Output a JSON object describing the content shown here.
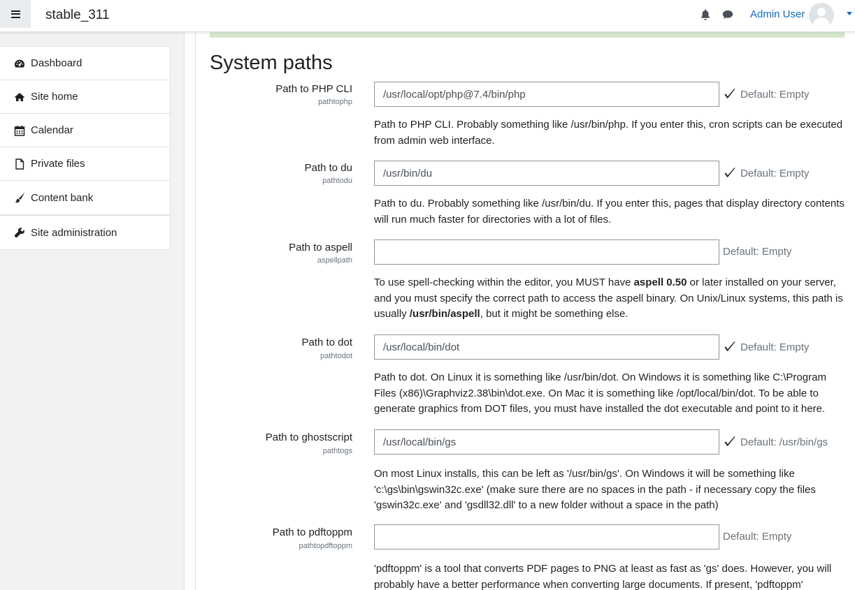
{
  "navbar": {
    "site_name": "stable_311",
    "user_name": "Admin User",
    "icons": [
      "menu-icon",
      "bell-icon",
      "chat-icon",
      "user-avatar",
      "caret-down-icon"
    ]
  },
  "drawer": {
    "items": [
      {
        "label": "Dashboard",
        "icon": "dashboard-icon"
      },
      {
        "label": "Site home",
        "icon": "home-icon"
      },
      {
        "label": "Calendar",
        "icon": "calendar-icon"
      },
      {
        "label": "Private files",
        "icon": "file-icon"
      },
      {
        "label": "Content bank",
        "icon": "paintbrush-icon"
      }
    ],
    "admin_item": {
      "label": "Site administration",
      "icon": "wrench-icon"
    }
  },
  "page": {
    "section_title": "System paths",
    "settings": [
      {
        "label": "Path to PHP CLI",
        "name": "pathtophp",
        "value": "/usr/local/opt/php@7.4/bin/php",
        "default": "Default: Empty",
        "changed": true,
        "description": "Path to PHP CLI. Probably something like /usr/bin/php. If you enter this, cron scripts can be executed from admin web interface."
      },
      {
        "label": "Path to du",
        "name": "pathtodu",
        "value": "/usr/bin/du",
        "default": "Default: Empty",
        "changed": true,
        "description": "Path to du. Probably something like /usr/bin/du. If you enter this, pages that display directory contents will run much faster for directories with a lot of files."
      },
      {
        "label": "Path to aspell",
        "name": "aspellpath",
        "value": "",
        "default": "Default: Empty",
        "changed": false,
        "description_parts": {
          "p1": "To use spell-checking within the editor, you MUST have ",
          "b1": "aspell 0.50",
          "p2": " or later installed on your server, and you must specify the correct path to access the aspell binary. On Unix/Linux systems, this path is usually ",
          "b2": "/usr/bin/aspell",
          "p3": ", but it might be something else."
        }
      },
      {
        "label": "Path to dot",
        "name": "pathtodot",
        "value": "/usr/local/bin/dot",
        "default": "Default: Empty",
        "changed": true,
        "description": "Path to dot. On Linux it is something like /usr/bin/dot. On Windows it is something like C:\\Program Files (x86)\\Graphviz2.38\\bin\\dot.exe. On Mac it is something like /opt/local/bin/dot. To be able to generate graphics from DOT files, you must have installed the dot executable and point to it here."
      },
      {
        "label": "Path to ghostscript",
        "name": "pathtogs",
        "value": "/usr/local/bin/gs",
        "default": "Default: /usr/bin/gs",
        "changed": true,
        "description": "On most Linux installs, this can be left as '/usr/bin/gs'. On Windows it will be something like 'c:\\gs\\bin\\gswin32c.exe' (make sure there are no spaces in the path - if necessary copy the files 'gswin32c.exe' and 'gsdll32.dll' to a new folder without a space in the path)"
      },
      {
        "label": "Path to pdftoppm",
        "name": "pathtopdftoppm",
        "value": "",
        "default": "Default: Empty",
        "changed": false,
        "description": "'pdftoppm' is a tool that converts PDF pages to PNG at least as fast as 'gs' does. However, you will probably have a better performance when converting large documents. If present, 'pdftoppm'"
      }
    ]
  },
  "colors": {
    "link": "#0f6cbf",
    "drawer_bg": "#f2f2f2",
    "success_bar": "#d7e8cf",
    "muted": "#6a737b"
  }
}
